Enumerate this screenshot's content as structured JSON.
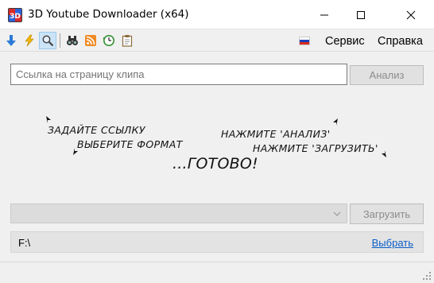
{
  "window": {
    "title": "3D Youtube Downloader (x64)"
  },
  "toolbar": {
    "buttons": [
      {
        "name": "download-icon",
        "color": "#2b7bd6"
      },
      {
        "name": "lightning-icon",
        "color": "#f2b600"
      },
      {
        "name": "magnifier-icon",
        "color": "#555555",
        "active": true
      },
      {
        "name": "binoculars-icon",
        "color": "#333333"
      },
      {
        "name": "rss-icon",
        "color": "#f08a24"
      },
      {
        "name": "clock-history-icon",
        "color": "#2f8f2f"
      },
      {
        "name": "clipboard-icon",
        "color": "#8a6a3a"
      }
    ],
    "language_flag": "russia-flag-icon",
    "menu": {
      "service": "Сервис",
      "help": "Справка"
    }
  },
  "url": {
    "placeholder": "Ссылка на страницу клипа",
    "value": ""
  },
  "analyze_button": "Анализ",
  "hints": {
    "step1": "ЗАДАЙТЕ ССЫЛКУ",
    "step2": "ВЫБЕРИТЕ ФОРМАТ",
    "step3": "НАЖМИТЕ 'АНАЛИЗ'",
    "step4": "НАЖМИТЕ 'ЗАГРУЗИТЬ'",
    "done": "...ГОТОВО!"
  },
  "format": {
    "selected": ""
  },
  "download_button": "Загрузить",
  "path": {
    "value": "F:\\",
    "browse": "Выбрать"
  },
  "colors": {
    "accent": "#0b5ec8",
    "disabled_text": "#8c8c8c"
  }
}
